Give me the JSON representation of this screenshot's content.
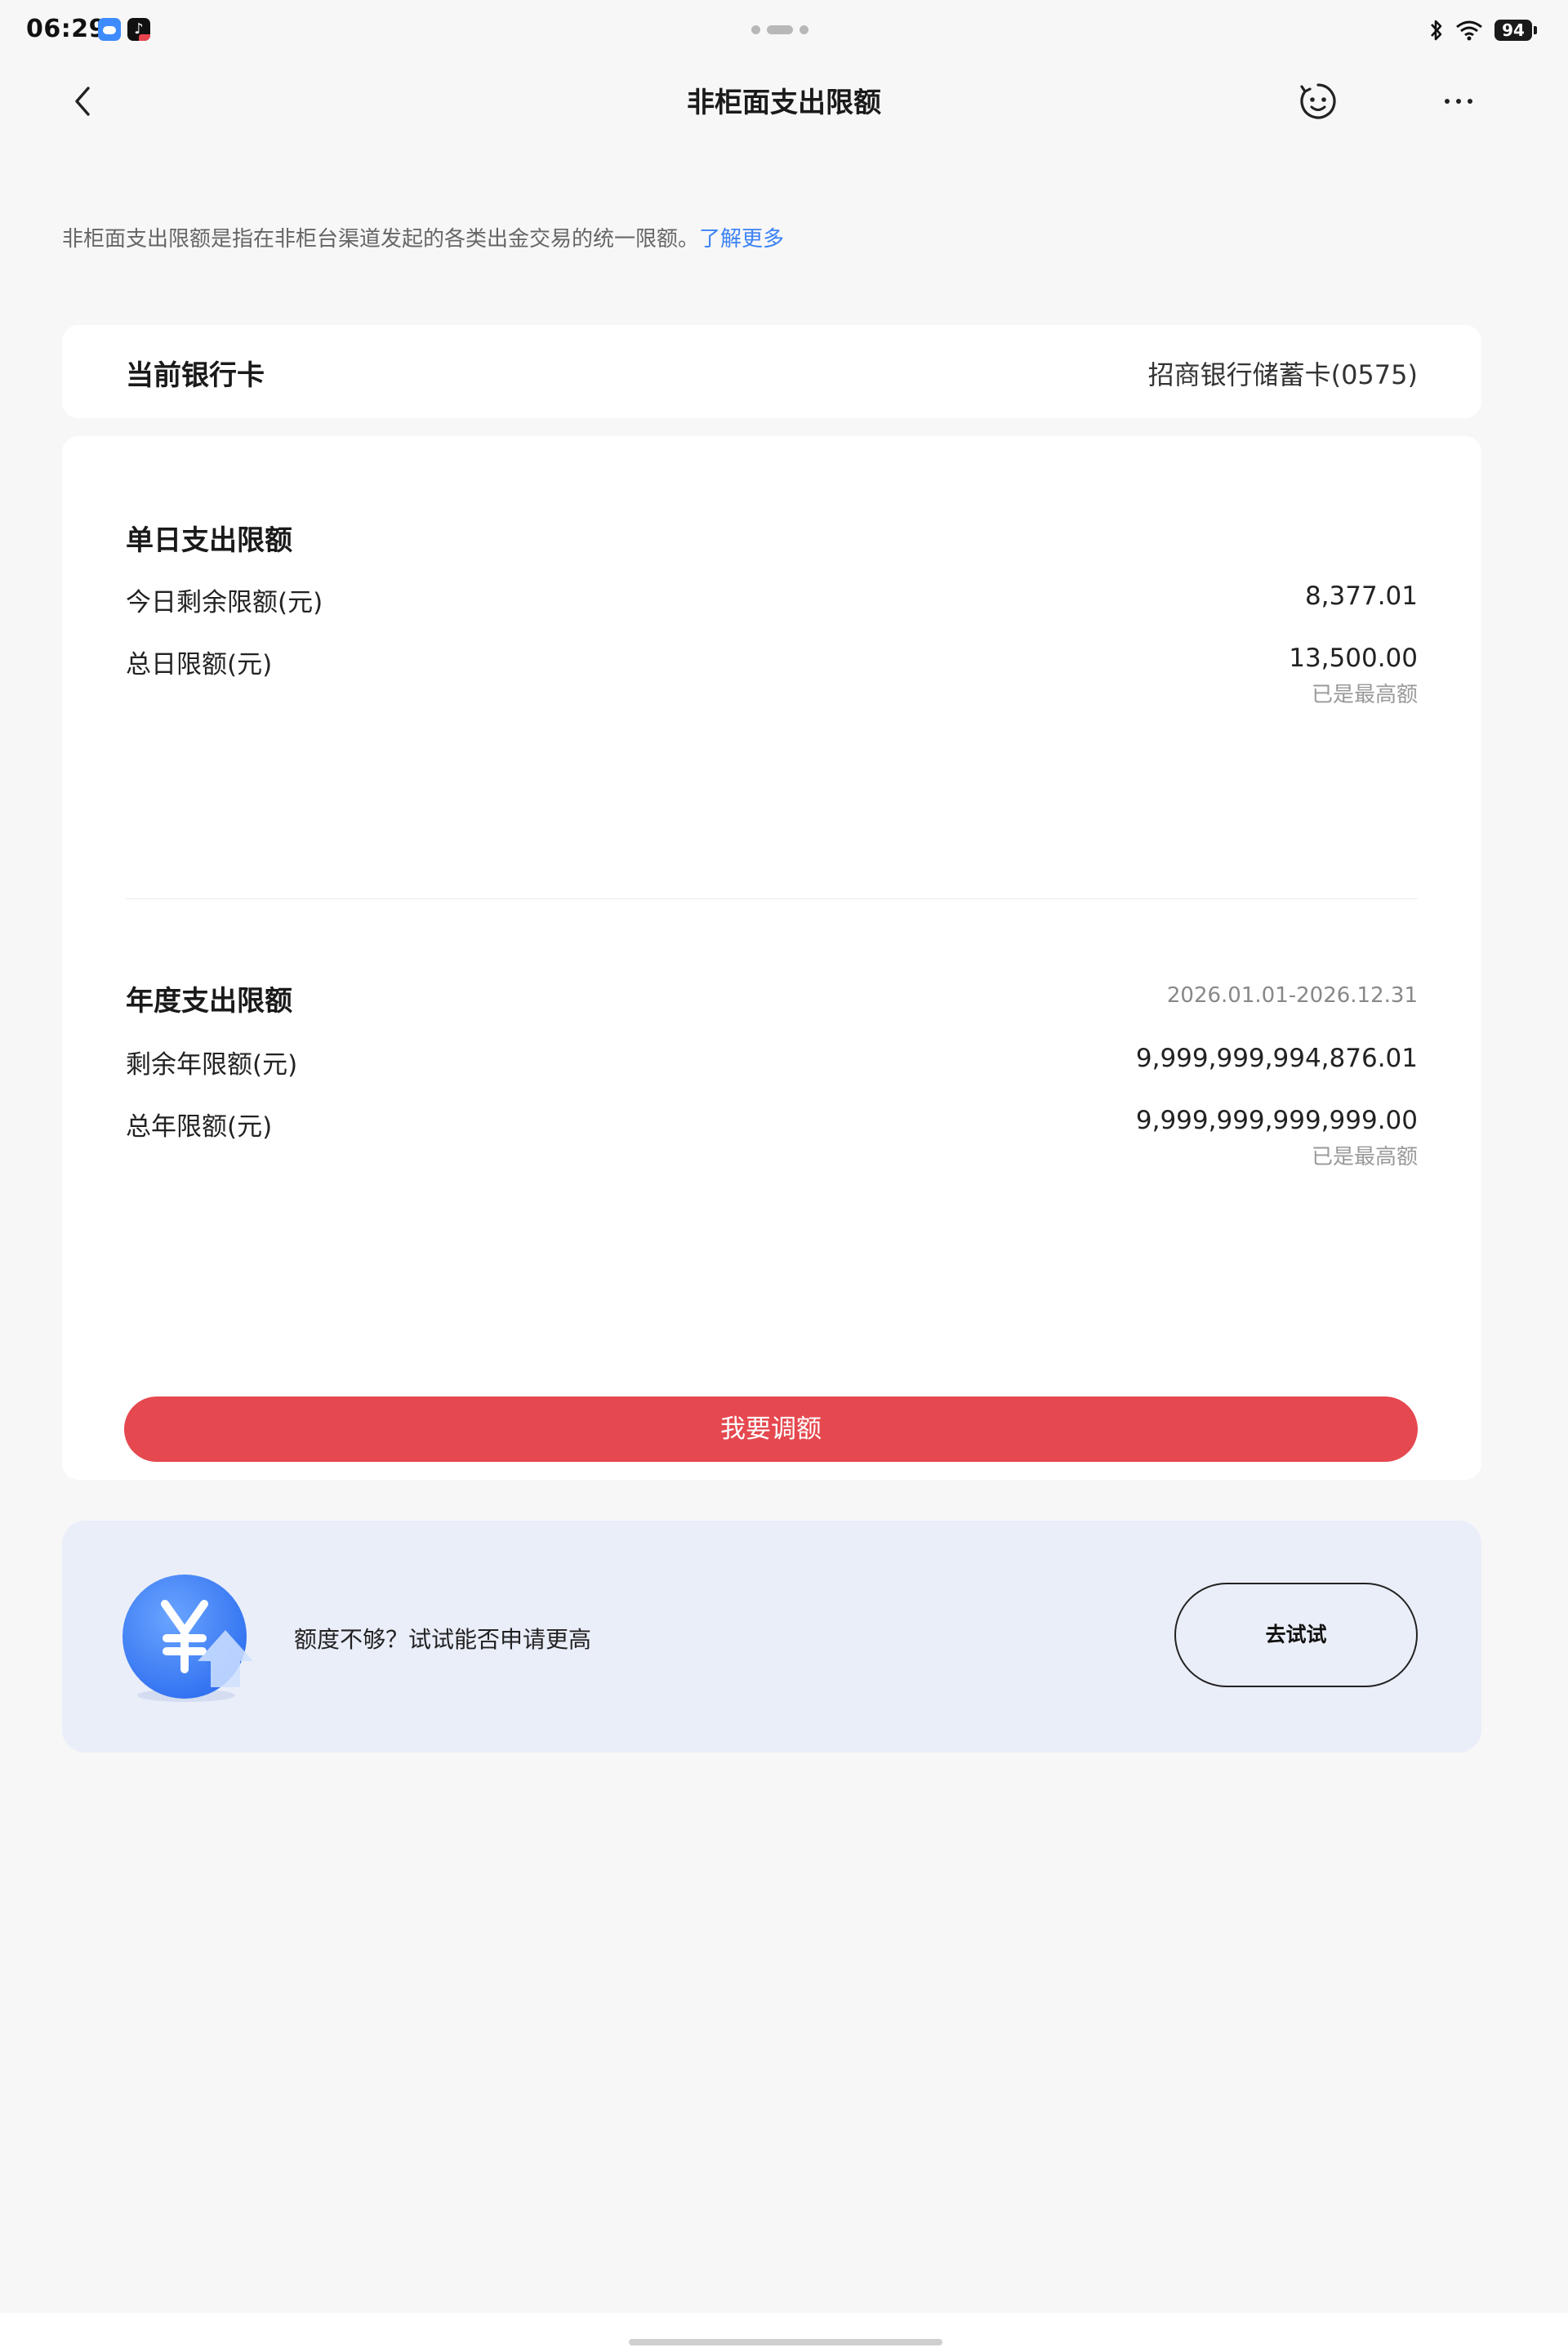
{
  "status_bar": {
    "time": "06:29",
    "battery": "94",
    "icons": [
      "weather-icon",
      "tiktok-icon",
      "bluetooth-icon",
      "wifi-icon",
      "battery-icon"
    ]
  },
  "nav": {
    "title": "非柜面支出限额",
    "icons": [
      "back-arrow-icon",
      "smiley-service-icon",
      "more-dots-icon"
    ]
  },
  "intro": {
    "text": "非柜面支出限额是指在非柜台渠道发起的各类出金交易的统一限额。",
    "link": "了解更多"
  },
  "bank_card": {
    "label": "当前银行卡",
    "value": "招商银行储蓄卡(0575)"
  },
  "daily": {
    "title": "单日支出限额",
    "rows": [
      {
        "label": "今日剩余限额(元)",
        "value": "8,377.01"
      },
      {
        "label": "总日限额(元)",
        "value": "13,500.00",
        "note": "已是最高额"
      }
    ]
  },
  "annual": {
    "title": "年度支出限额",
    "period": "2026.01.01-2026.12.31",
    "rows": [
      {
        "label": "剩余年限额(元)",
        "value": "9,999,999,994,876.01"
      },
      {
        "label": "总年限额(元)",
        "value": "9,999,999,999,999.00",
        "note": "已是最高额"
      }
    ]
  },
  "adjust_button": "我要调额",
  "promo": {
    "text": "额度不够？试试能否申请更高",
    "button": "去试试",
    "icon": "yuan-up-arrow-icon"
  },
  "colors": {
    "background": "#f7f7f7",
    "accent_red": "#e5484f",
    "link_blue": "#3b82f6",
    "promo_bg": "#eaeef9"
  }
}
